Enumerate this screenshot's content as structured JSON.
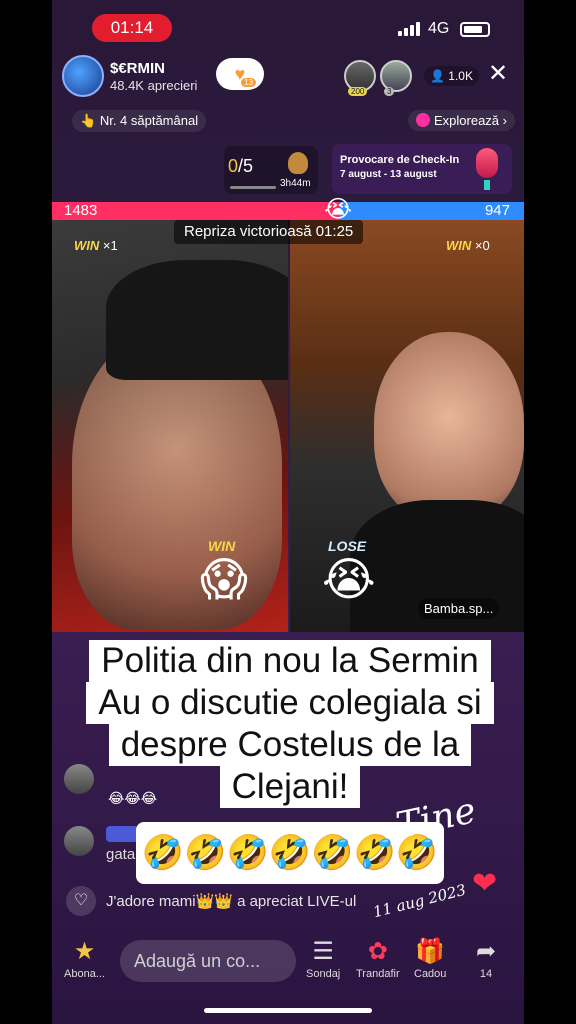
{
  "status_bar": {
    "time": "01:14",
    "network": "4G"
  },
  "host": {
    "name": "$€RMIN",
    "likes": "48.4K aprecieri",
    "follow_count": "13"
  },
  "viewers": {
    "badge1": "200",
    "badge2": "3",
    "count": "1.0K"
  },
  "rank_label": "Nr. 4 săptămânal",
  "explore_label": "Explorează ›",
  "goal": {
    "current": "0",
    "total": "/5",
    "timer": "3h44m"
  },
  "checkin": {
    "title": "Provocare de Check-In",
    "dates": "7 august - 13 august"
  },
  "battle": {
    "score_left": "1483",
    "score_right": "947",
    "left_share": 0.61,
    "round_label": "Repriza victorioasă  01:25",
    "left_win_label": "WIN",
    "left_win_count": "×1",
    "right_win_label": "WIN",
    "right_win_count": "×0",
    "left_result": "WIN",
    "right_result": "LOSE",
    "opponent_name": "Bamba.sp..."
  },
  "chat": {
    "row1_emojis": "😂😂😂",
    "row2_name": "gata",
    "liked_text": "J'adore mami👑👑 a apreciat LIVE-ul"
  },
  "caption": {
    "lines": [
      "Politia din nou la Sermin",
      "Au o discutie colegiala si",
      "despre Costelus de la",
      "Clejani!"
    ],
    "emojis": "🤣🤣🤣🤣🤣🤣🤣"
  },
  "handwriting": {
    "text": "Tine",
    "date": "11 aug 2023"
  },
  "bottom_bar": {
    "subscribe": "Abona...",
    "comment_placeholder": "Adaugă un co...",
    "poll": "Sondaj",
    "rose": "Trandafir",
    "gift": "Cadou",
    "share_count": "14"
  },
  "colors": {
    "red": "#ff2e63",
    "blue": "#2f8cff",
    "time_pill": "#e11d2e",
    "win_gold": "#f8d648"
  },
  "icons": [
    "heart-icon",
    "close-icon",
    "person-icon",
    "star-icon",
    "poll-icon",
    "rose-icon",
    "gift-icon",
    "share-icon"
  ]
}
